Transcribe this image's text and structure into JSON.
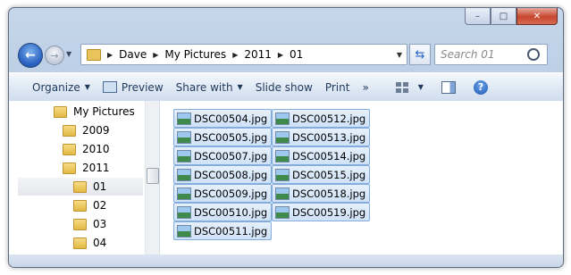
{
  "window": {
    "caption_min": "–",
    "caption_max": "□",
    "caption_close": "✕"
  },
  "nav": {
    "back_glyph": "←",
    "forward_glyph": "→",
    "dropdown_glyph": "▼",
    "breadcrumb": [
      "Dave",
      "My Pictures",
      "2011",
      "01"
    ],
    "separator": "▶",
    "refresh_glyph": "⇆",
    "search_placeholder": "Search 01"
  },
  "toolbar": {
    "organize": "Organize",
    "preview": "Preview",
    "share_with": "Share with",
    "slide_show": "Slide show",
    "print": "Print",
    "more": "»",
    "caret": "▼",
    "help": "?"
  },
  "tree": {
    "items": [
      {
        "label": "My Pictures"
      },
      {
        "label": "2009"
      },
      {
        "label": "2010"
      },
      {
        "label": "2011"
      },
      {
        "label": "01",
        "selected": true
      },
      {
        "label": "02"
      },
      {
        "label": "03"
      },
      {
        "label": "04"
      }
    ]
  },
  "files": {
    "column1": [
      "DSC00504.jpg",
      "DSC00505.jpg",
      "DSC00507.jpg",
      "DSC00508.jpg",
      "DSC00509.jpg",
      "DSC00510.jpg",
      "DSC00511.jpg"
    ],
    "column2": [
      "DSC00512.jpg",
      "DSC00513.jpg",
      "DSC00514.jpg",
      "DSC00515.jpg",
      "DSC00518.jpg",
      "DSC00519.jpg"
    ]
  }
}
